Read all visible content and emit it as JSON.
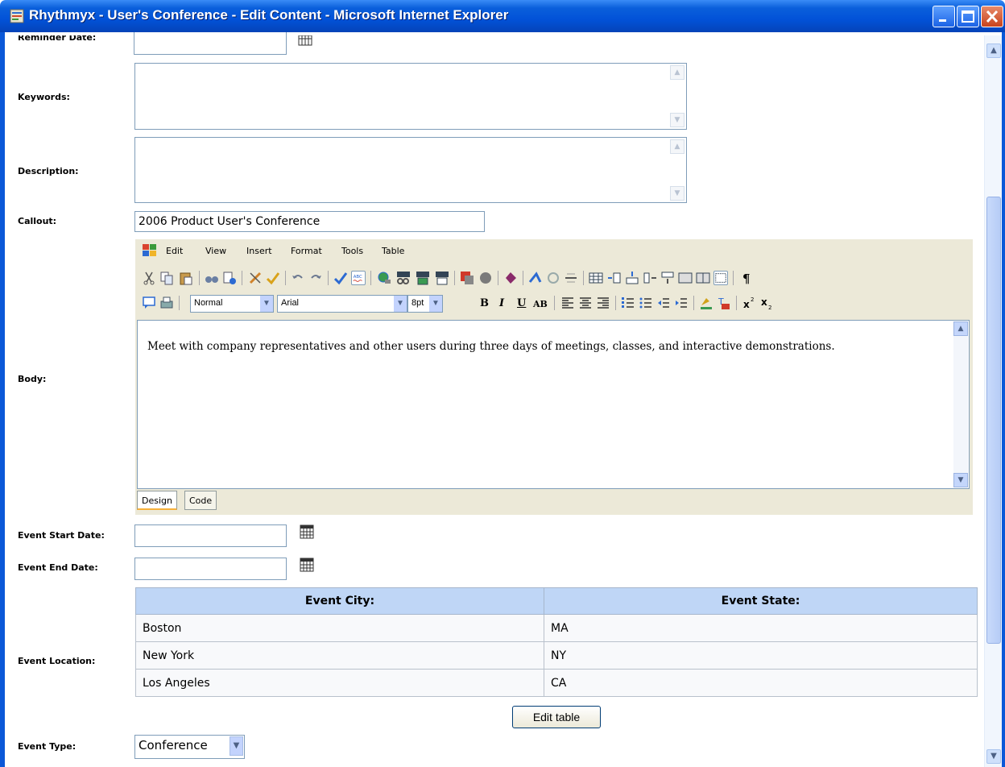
{
  "window": {
    "title": "Rhythmyx - User's Conference - Edit Content - Microsoft Internet Explorer"
  },
  "fields": {
    "reminder_date_label": "Reminder Date:",
    "keywords_label": "Keywords:",
    "description_label": "Description:",
    "callout_label": "Callout:",
    "callout_value": "2006 Product User's Conference",
    "body_label": "Body:",
    "event_start_label": "Event Start Date:",
    "event_end_label": "Event End Date:",
    "event_location_label": "Event Location:",
    "event_type_label": "Event Type:",
    "event_type_value": "Conference"
  },
  "editor": {
    "menu": [
      "Edit",
      "View",
      "Insert",
      "Format",
      "Tools",
      "Table"
    ],
    "style_value": "Normal",
    "font_value": "Arial",
    "size_value": "8pt",
    "bold": "B",
    "italic": "I",
    "underline": "U",
    "caps": "AB",
    "body_text": "Meet with company representatives and other users during three days of meetings, classes, and interactive demonstrations.",
    "tabs": [
      "Design",
      "Code"
    ]
  },
  "location_table": {
    "headers": [
      "Event City:",
      "Event State:"
    ],
    "rows": [
      [
        "Boston",
        "MA"
      ],
      [
        "New York",
        "NY"
      ],
      [
        "Los Angeles",
        "CA"
      ]
    ],
    "edit_button": "Edit table"
  }
}
